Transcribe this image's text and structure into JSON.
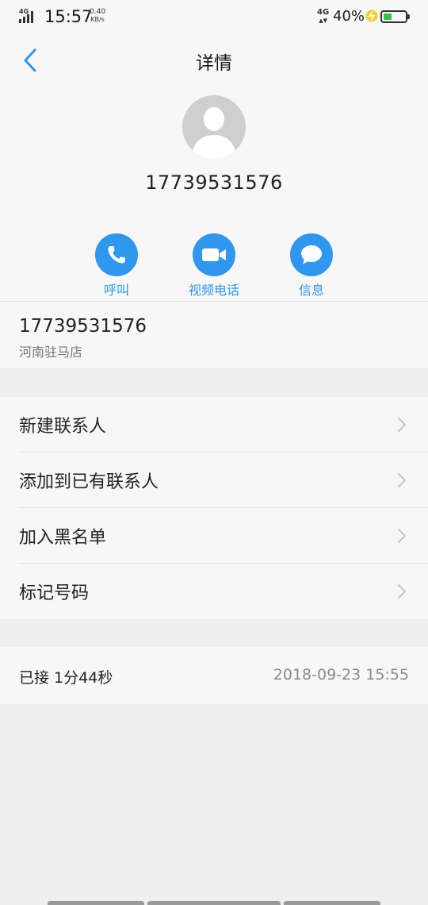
{
  "status_bar": {
    "network_left": "4G",
    "time": "15:57",
    "speed_value": "0.40",
    "speed_unit": "KB/s",
    "network_right": "4G",
    "battery_percent": "40%",
    "battery_level": 0.4,
    "battery_color": "#2ec34a"
  },
  "header": {
    "title": "详情",
    "back_icon": "chevron-left-icon"
  },
  "contact": {
    "avatar_icon": "person-silhouette-icon",
    "phone_number": "17739531576"
  },
  "actions": [
    {
      "label": "呼叫",
      "icon": "phone-icon"
    },
    {
      "label": "视频电话",
      "icon": "video-camera-icon"
    },
    {
      "label": "信息",
      "icon": "message-bubble-icon"
    }
  ],
  "number_info": {
    "number": "17739531576",
    "location": "河南驻马店"
  },
  "menu": {
    "items": [
      {
        "label": "新建联系人"
      },
      {
        "label": "添加到已有联系人"
      },
      {
        "label": "加入黑名单"
      },
      {
        "label": "标记号码"
      }
    ]
  },
  "call_record": {
    "status": "已接 1分44秒",
    "datetime": "2018-09-23 15:55"
  },
  "colors": {
    "accent": "#2f97ed",
    "background": "#efefef",
    "card": "#f7f7f7"
  }
}
